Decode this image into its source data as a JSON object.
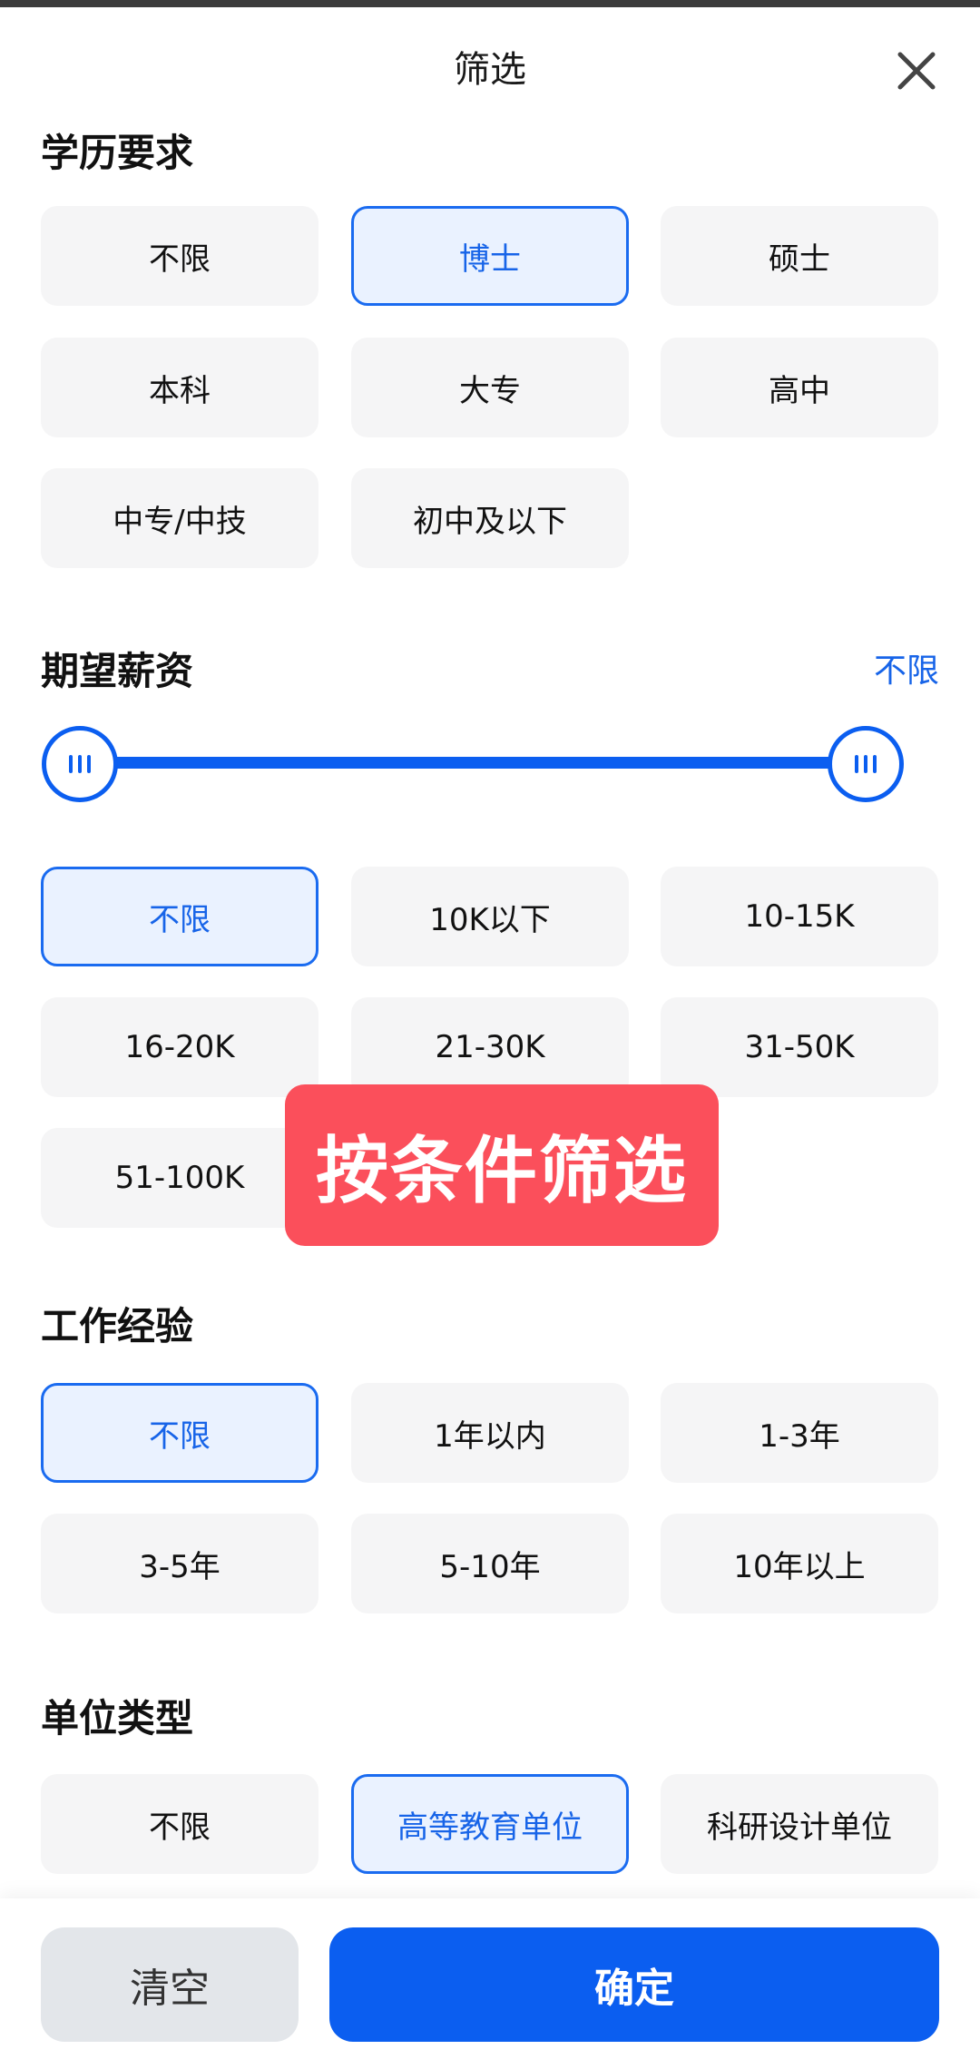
{
  "header": {
    "title": "筛选"
  },
  "education": {
    "title": "学历要求",
    "options": [
      {
        "label": "不限",
        "selected": false
      },
      {
        "label": "博士",
        "selected": true
      },
      {
        "label": "硕士",
        "selected": false
      },
      {
        "label": "本科",
        "selected": false
      },
      {
        "label": "大专",
        "selected": false
      },
      {
        "label": "高中",
        "selected": false
      },
      {
        "label": "中专/中技",
        "selected": false
      },
      {
        "label": "初中及以下",
        "selected": false
      }
    ]
  },
  "salary": {
    "title": "期望薪资",
    "range_label": "不限",
    "slider": {
      "min_fraction": 0,
      "max_fraction": 1
    },
    "options": [
      {
        "label": "不限",
        "selected": true
      },
      {
        "label": "10K以下",
        "selected": false
      },
      {
        "label": "10-15K",
        "selected": false
      },
      {
        "label": "16-20K",
        "selected": false
      },
      {
        "label": "21-30K",
        "selected": false
      },
      {
        "label": "31-50K",
        "selected": false
      },
      {
        "label": "51-100K",
        "selected": false
      }
    ]
  },
  "overlay": {
    "text": "按条件筛选"
  },
  "experience": {
    "title": "工作经验",
    "options": [
      {
        "label": "不限",
        "selected": true
      },
      {
        "label": "1年以内",
        "selected": false
      },
      {
        "label": "1-3年",
        "selected": false
      },
      {
        "label": "3-5年",
        "selected": false
      },
      {
        "label": "5-10年",
        "selected": false
      },
      {
        "label": "10年以上",
        "selected": false
      }
    ]
  },
  "org_type": {
    "title": "单位类型",
    "options": [
      {
        "label": "不限",
        "selected": false
      },
      {
        "label": "高等教育单位",
        "selected": true
      },
      {
        "label": "科研设计单位",
        "selected": false
      }
    ]
  },
  "footer": {
    "clear_label": "清空",
    "confirm_label": "确定"
  },
  "colors": {
    "accent": "#0b5ef0",
    "selected_bg": "#eaf2ff",
    "chip_bg": "#f5f5f6",
    "overlay": "#fb4f5b"
  }
}
